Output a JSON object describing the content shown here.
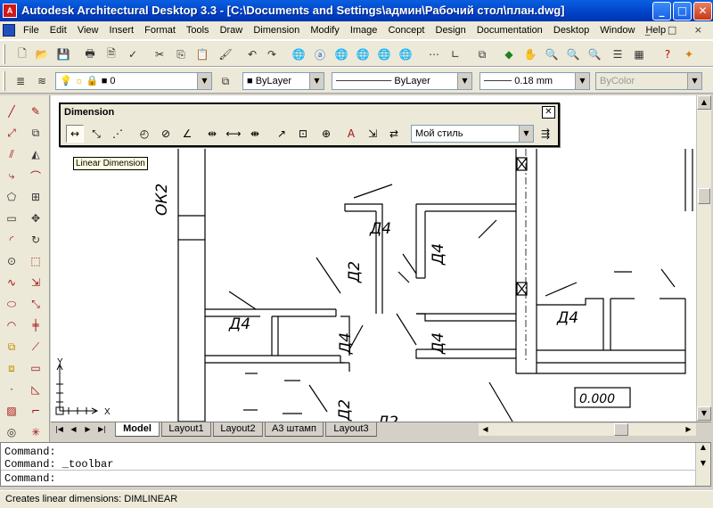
{
  "window": {
    "title": "Autodesk Architectural Desktop 3.3 - [C:\\Documents and Settings\\админ\\Рабочий стол\\план.dwg]",
    "buttons": [
      "_",
      "□",
      "✕"
    ]
  },
  "menubar": {
    "items": [
      "File",
      "Edit",
      "View",
      "Insert",
      "Format",
      "Tools",
      "Draw",
      "Dimension",
      "Modify",
      "Image",
      "Concept",
      "Design",
      "Documentation",
      "Desktop",
      "Window",
      "Help"
    ],
    "mdi_buttons": "_ □ ×"
  },
  "layers_toolbar": {
    "layer_value": "0",
    "color_value": "ByLayer",
    "linetype_value": "ByLayer",
    "lineweight_value": "0.18 mm",
    "plotstyle_value": "ByColor"
  },
  "dimension_toolbar": {
    "title": "Dimension",
    "style_value": "Мой стиль",
    "tooltip": "Linear Dimension"
  },
  "drawing": {
    "room_labels": [
      "Д4",
      "Д4",
      "Д4",
      "Д4",
      "Д4",
      "Д4"
    ],
    "door_labels": [
      "Д2",
      "Д2",
      "Д2"
    ],
    "wall_label": "ОК2",
    "elevation": "0.000",
    "ucs_x": "X",
    "ucs_y": "Y"
  },
  "tabs": [
    "Model",
    "Layout1",
    "Layout2",
    "А3 штамп",
    "Layout3"
  ],
  "command_window": {
    "lines": [
      "Command:",
      "Command: _toolbar",
      "Command:"
    ]
  },
  "status": {
    "text": "Creates linear dimensions:  DIMLINEAR"
  }
}
